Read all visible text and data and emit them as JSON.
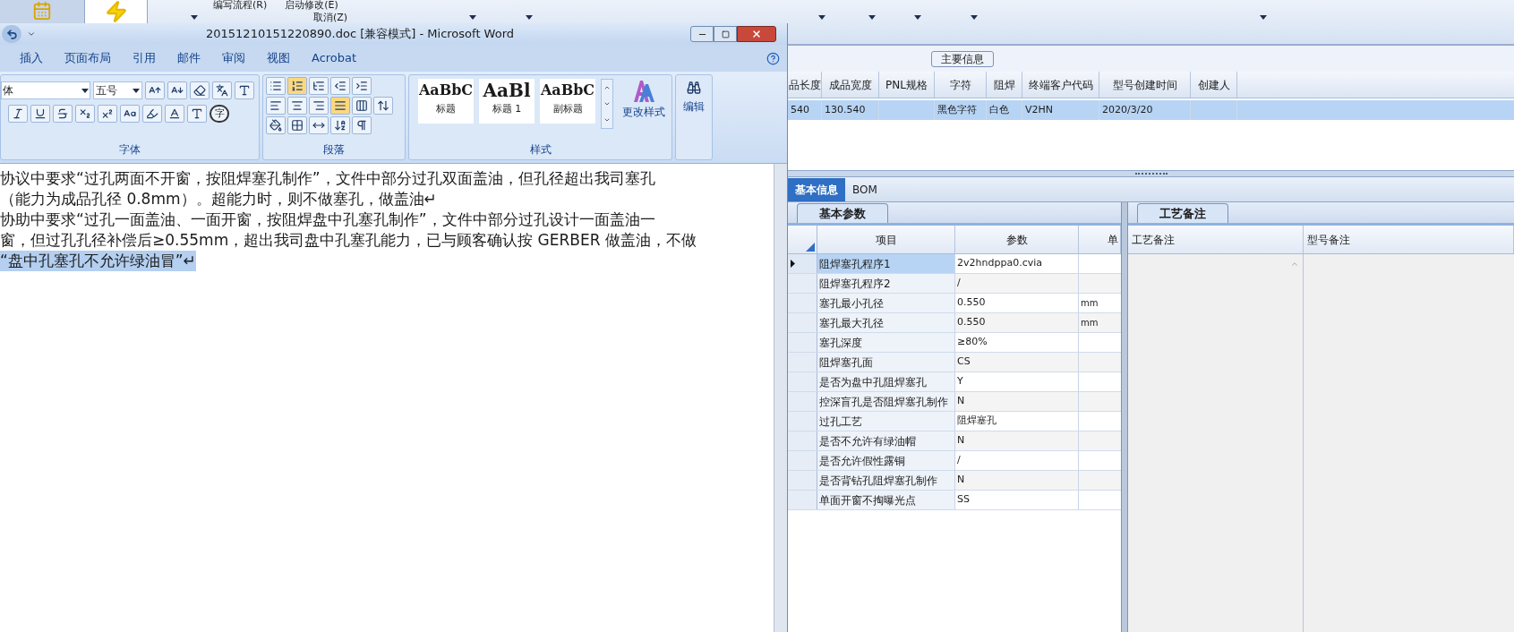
{
  "app_toolbar": {
    "items": [
      "编写流程(R)",
      "启动修改(E)"
    ],
    "cancel": "取消(Z)"
  },
  "main_info": {
    "title": "主要信息",
    "columns": [
      "品长度",
      "成品宽度",
      "PNL规格",
      "字符",
      "阻焊",
      "终端客户代码",
      "型号创建时间",
      "创建人"
    ],
    "rows": [
      {
        "selected": true,
        "cells": [
          "540",
          "130.540",
          null,
          "黑色字符",
          "白色",
          "V2HN",
          "2020/3/20",
          null
        ]
      }
    ]
  },
  "detail_tabs": [
    {
      "label": "基本信息",
      "selected": true
    },
    {
      "label": "BOM",
      "selected": false
    }
  ],
  "params_panel": {
    "tab": "基本参数",
    "columns": [
      "项目",
      "参数",
      "单"
    ],
    "rows": [
      {
        "item": "阻焊塞孔程序1",
        "value": "2v2hndppa0.cvia",
        "selected": true
      },
      {
        "item": "阻焊塞孔程序2",
        "value": "/",
        "selected": false
      },
      {
        "item": "塞孔最小孔径",
        "value": "0.550",
        "unit": "mm",
        "selected": false
      },
      {
        "item": "塞孔最大孔径",
        "value": "0.550",
        "unit": "mm",
        "selected": false
      },
      {
        "item": "塞孔深度",
        "value": "≥80%",
        "selected": false
      },
      {
        "item": "阻焊塞孔面",
        "value": "CS",
        "selected": false
      },
      {
        "item": "是否为盘中孔阻焊塞孔",
        "value": "Y",
        "selected": false
      },
      {
        "item": "控深盲孔是否阻焊塞孔制作",
        "value": "N",
        "selected": false
      },
      {
        "item": "过孔工艺",
        "value": "阻焊塞孔",
        "selected": false
      },
      {
        "item": "是否不允许有绿油帽",
        "value": "N",
        "selected": false
      },
      {
        "item": "是否允许假性露铜",
        "value": "/",
        "selected": false
      },
      {
        "item": "是否背钻孔阻焊塞孔制作",
        "value": "N",
        "selected": false
      },
      {
        "item": "单面开窗不掏曝光点",
        "value": "SS",
        "selected": false
      }
    ]
  },
  "notes_panel": {
    "tab": "工艺备注",
    "columns": [
      "工艺备注",
      "型号备注"
    ]
  },
  "word": {
    "title": "20151210151220890.doc [兼容模式] - Microsoft Word",
    "tabs": [
      {
        "label": "插入",
        "selected": false
      },
      {
        "label": "页面布局",
        "selected": false
      },
      {
        "label": "引用",
        "selected": false
      },
      {
        "label": "邮件",
        "selected": false
      },
      {
        "label": "审阅",
        "selected": false
      },
      {
        "label": "视图",
        "selected": false
      },
      {
        "label": "Acrobat",
        "selected": false
      }
    ],
    "font": {
      "name": "体",
      "size": "五号",
      "enclose_char": "字"
    },
    "styles": [
      {
        "preview": "AaBbC",
        "label": "标题"
      },
      {
        "preview": "AaBl",
        "label": "标题 1"
      },
      {
        "preview": "AaBbC",
        "label": "副标题"
      }
    ],
    "change_styles": "更改样式",
    "editing": "编辑",
    "groups": [
      "字体",
      "段落",
      "样式"
    ],
    "document": {
      "lines": [
        {
          "text": "协议中要求“过孔两面不开窗，按阻焊塞孔制作”，文件中部分过孔双面盖油，但孔径超出我司塞孔",
          "selected": false
        },
        {
          "text": "（能力为成品孔径 0.8mm）。超能力时，则不做塞孔，做盖油↵",
          "selected": false
        },
        {
          "text": "协助中要求“过孔一面盖油、一面开窗，按阻焊盘中孔塞孔制作”，文件中部分过孔设计一面盖油一",
          "selected": false
        },
        {
          "text": "窗，但过孔孔径补偿后≥0.55mm，超出我司盘中孔塞孔能力，已与顾客确认按 GERBER 做盖油，不做",
          "selected": false
        },
        {
          "text": "“盘中孔塞孔不允许绿油冒”↵",
          "selected": true
        }
      ]
    }
  }
}
